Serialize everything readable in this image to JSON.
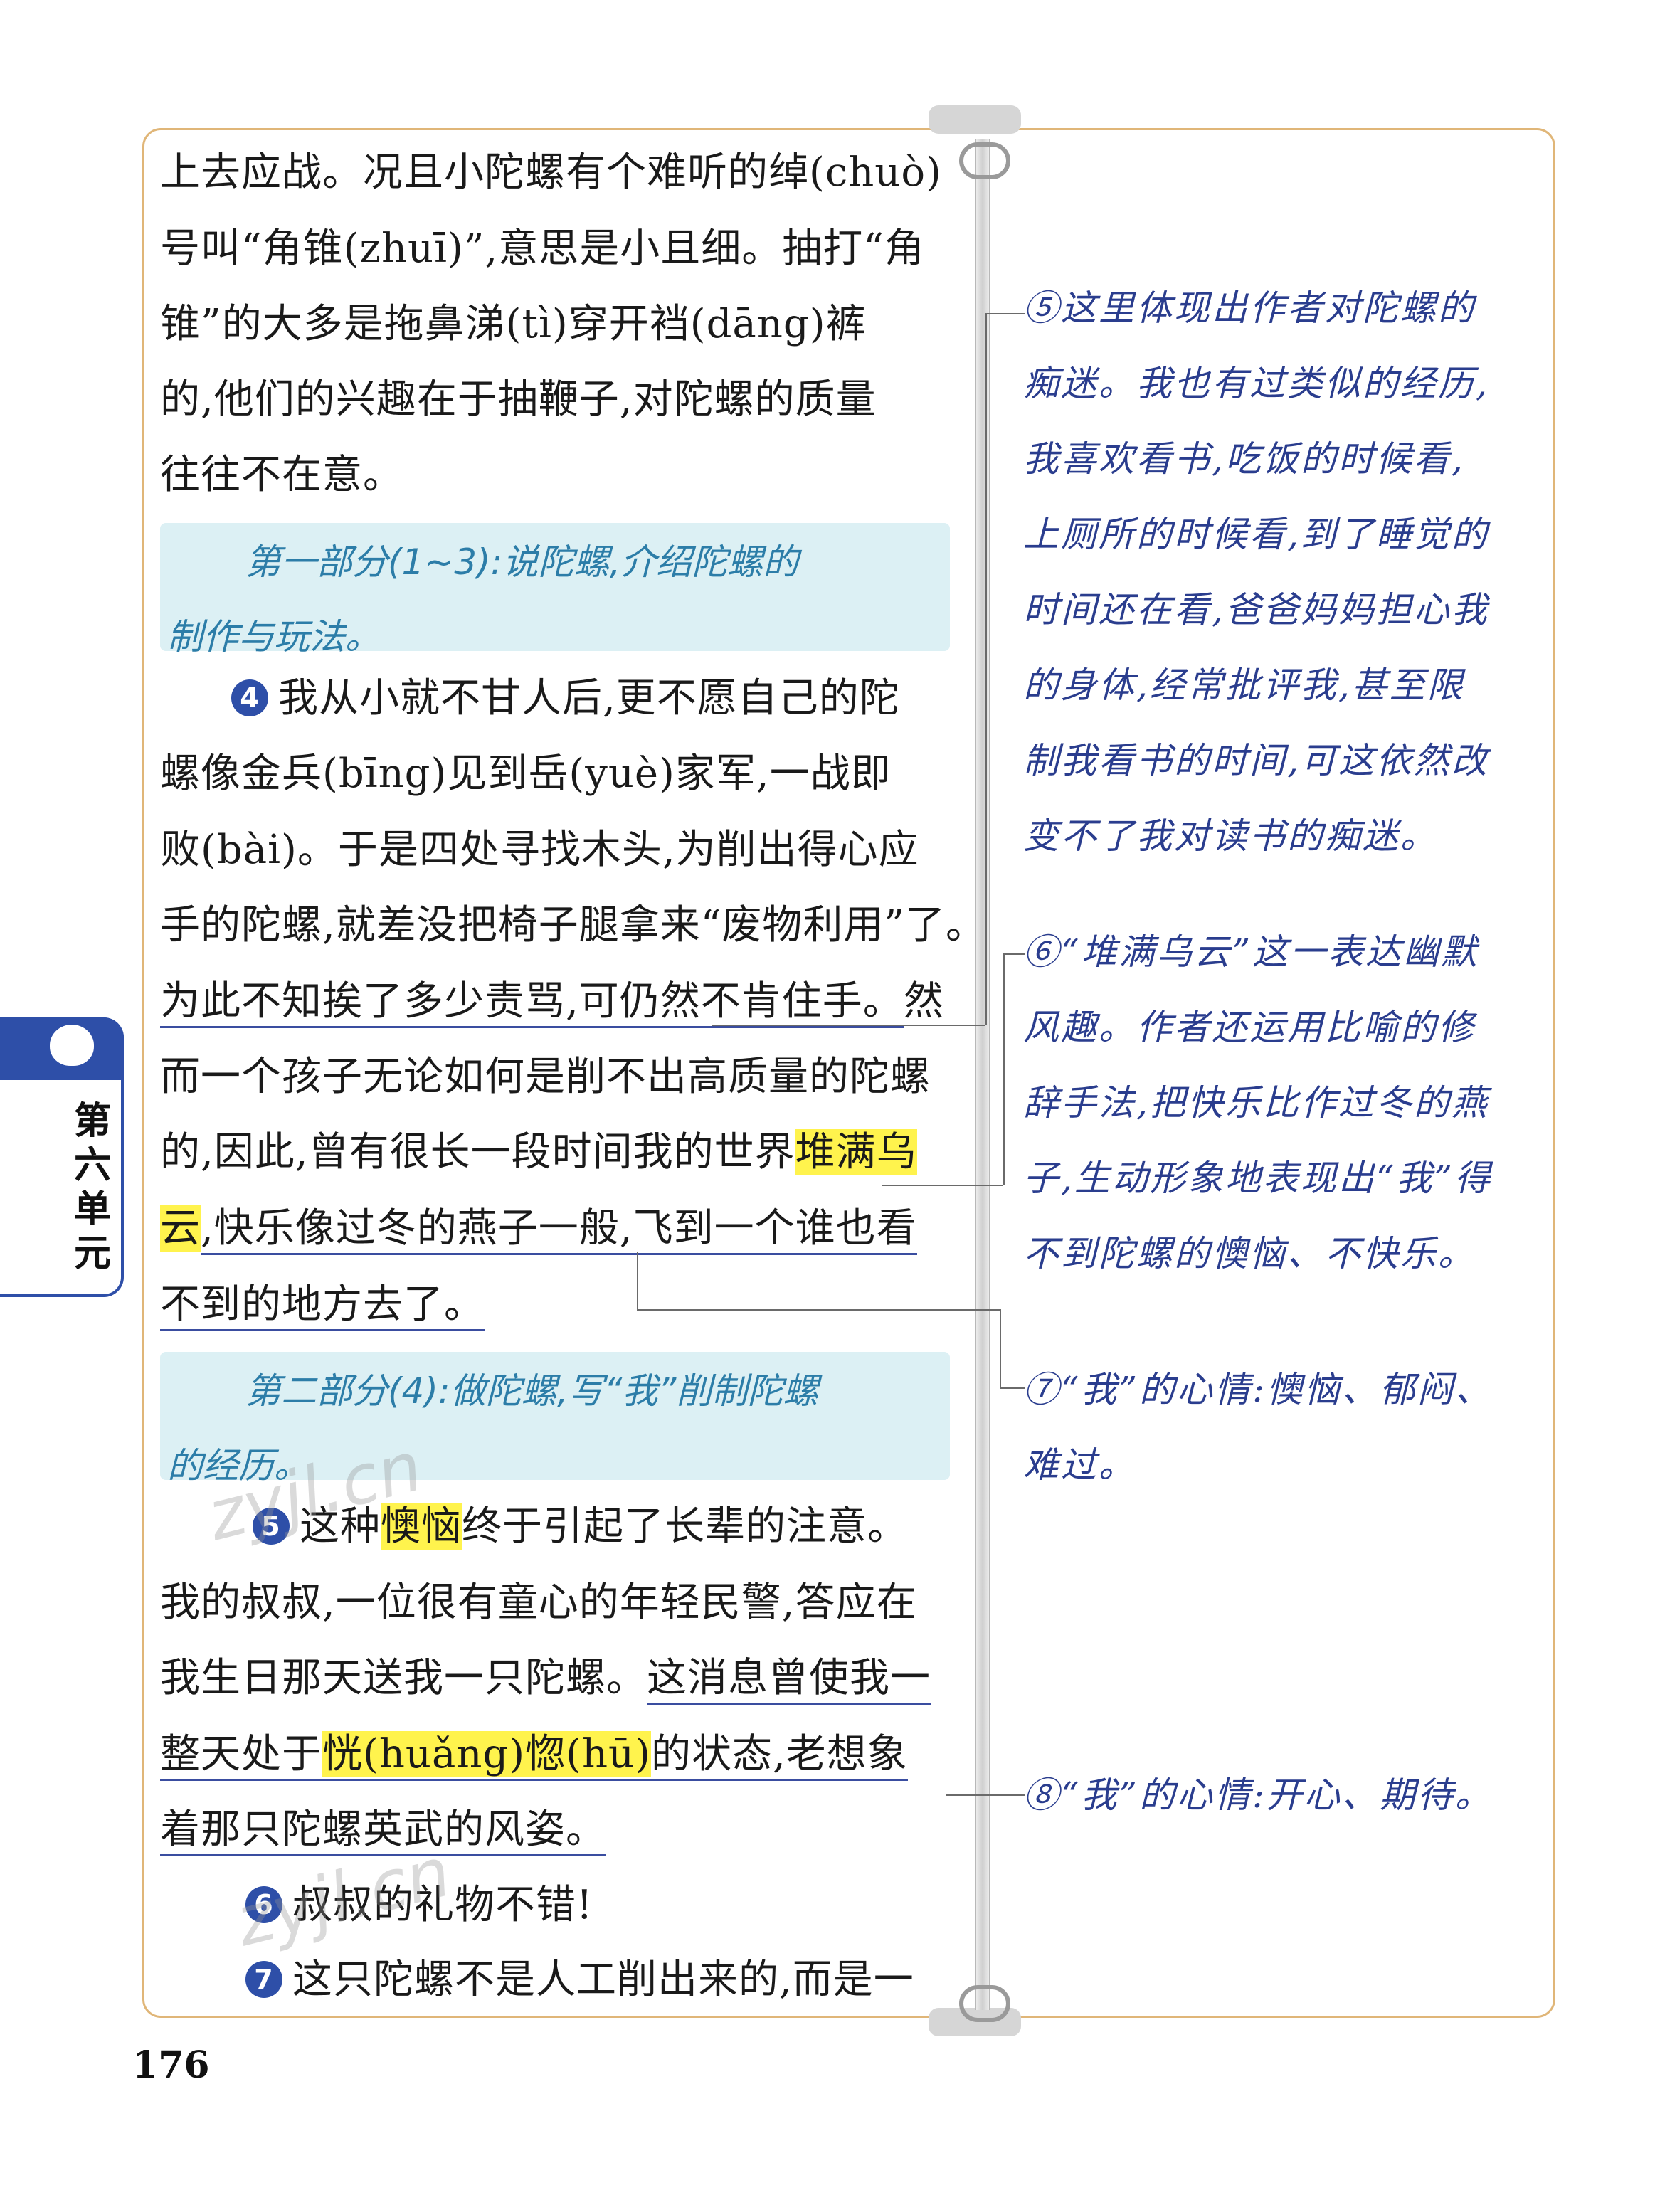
{
  "main_text": {
    "l1": "上去应战。况且小陀螺有个难听的绰(chuò)",
    "l2": "号叫“角锥(zhuī)”,意思是小且细。抽打“角",
    "l3": "锥”的大多是拖鼻涕(tì)穿开裆(dāng)裤",
    "l4": "的,他们的兴趣在于抽鞭子,对陀螺的质量",
    "l5": "往往不在意。",
    "p4_num": "4",
    "l6": "我从小就不甘人后,更不愿自己的陀",
    "l7": "螺像金兵(bīng)见到岳(yuè)家军,一战即",
    "l8": "败(bài)。于是四处寻找木头,为削出得心应",
    "l9": "手的陀螺,就差没把椅子腿拿来“废物利用”了。",
    "l10_u": "为此不知挨了多少责骂,可仍然不肯住手。",
    "l10_tail": "然",
    "l11": "而一个孩子无论如何是削不出高质量的陀螺",
    "l12_a": "的,因此,曾有很长一段时间我的世界",
    "l12_hl": "堆满乌",
    "l13_hl": "云",
    "l13_u": ",快乐像过冬的燕子一般,飞到一个谁也看",
    "l14_u": "不到的地方去了。",
    "p5_num": "5",
    "l15_a": "这种",
    "l15_hl": "懊恼",
    "l15_b": "终于引起了长辈的注意。",
    "l16": "我的叔叔,一位很有童心的年轻民警,答应在",
    "l17_a": "我生日那天送我一只陀螺。",
    "l17_u": "这消息曾使我一",
    "l18_a": "整天处于",
    "l18_hl1": "恍(huǎng)惚(hū)",
    "l18_b": "的状态,老想象",
    "l19_u": "着那只陀螺英武的风姿。",
    "p6_num": "6",
    "l20": "叔叔的礼物不错!",
    "p7_num": "7",
    "l21": "这只陀螺不是人工削出来的,而是一"
  },
  "summaries": {
    "s1_l1": "第一部分(1~3):说陀螺,介绍陀螺的",
    "s1_l2": "制作与玩法。",
    "s2_l1": "第二部分(4):做陀螺,写“我”削制陀螺",
    "s2_l2": "的经历。"
  },
  "notes": {
    "n5_l1": "⑤这里体现出作者对陀螺的",
    "n5_l2": "痴迷。我也有过类似的经历,",
    "n5_l3": "我喜欢看书,吃饭的时候看,",
    "n5_l4": "上厕所的时候看,到了睡觉的",
    "n5_l5": "时间还在看,爸爸妈妈担心我",
    "n5_l6": "的身体,经常批评我,甚至限",
    "n5_l7": "制我看书的时间,可这依然改",
    "n5_l8": "变不了我对读书的痴迷。",
    "n6_l1": "⑥“堆满乌云”这一表达幽默",
    "n6_l2": "风趣。作者还运用比喻的修",
    "n6_l3": "辞手法,把快乐比作过冬的燕",
    "n6_l4": "子,生动形象地表现出“我”得",
    "n6_l5": "不到陀螺的懊恼、不快乐。",
    "n7_l1": "⑦“我”的心情:懊恼、郁闷、",
    "n7_l2": "难过。",
    "n8_l1": "⑧“我”的心情:开心、期待。"
  },
  "side_tab": {
    "chars": [
      "第",
      "六",
      "单",
      "元"
    ]
  },
  "page_number": "176",
  "watermarks": [
    "zyjl.cn",
    "zyjl.cn"
  ],
  "colors": {
    "frame": "#e0b678",
    "accent_blue": "#2e4fa8",
    "highlight": "#fff34d",
    "summary_bg": "#dcf0f4",
    "note_ink": "#2a3d8e"
  }
}
